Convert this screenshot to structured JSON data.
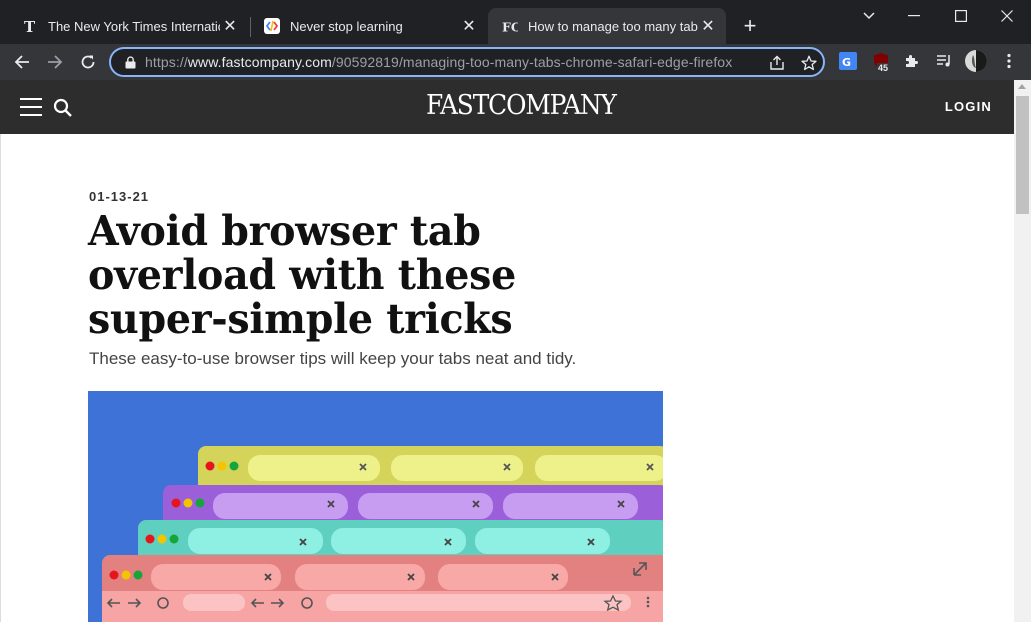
{
  "tabs": [
    {
      "title": "The New York Times International",
      "icon": "nyt-favicon",
      "active": false
    },
    {
      "title": "Never stop learning",
      "icon": "codecademy-favicon",
      "active": false
    },
    {
      "title": "How to manage too many tabs o",
      "icon": "fastcompany-favicon",
      "active": true
    }
  ],
  "tab_close_glyph": "✕",
  "new_tab_glyph": "+",
  "url": {
    "scheme": "https://",
    "host": "www.fastcompany.com",
    "path": "/90592819/managing-too-many-tabs-chrome-safari-edge-firefox"
  },
  "extensions": {
    "ublock_badge": "45"
  },
  "site": {
    "logo": "FASTCOMPANY",
    "login": "LOGIN"
  },
  "article": {
    "date": "01-13-21",
    "headline": "Avoid browser tab overload with these super-simple tricks",
    "dek": "These easy-to-use browser tips will keep your tabs neat and tidy."
  },
  "colors": {
    "browser_dark": "#202124",
    "toolbar": "#35363a",
    "omnibox_focus": "#8ab4f8",
    "site_header": "#2d2d2d",
    "hero_bg": "#3f72d6"
  }
}
